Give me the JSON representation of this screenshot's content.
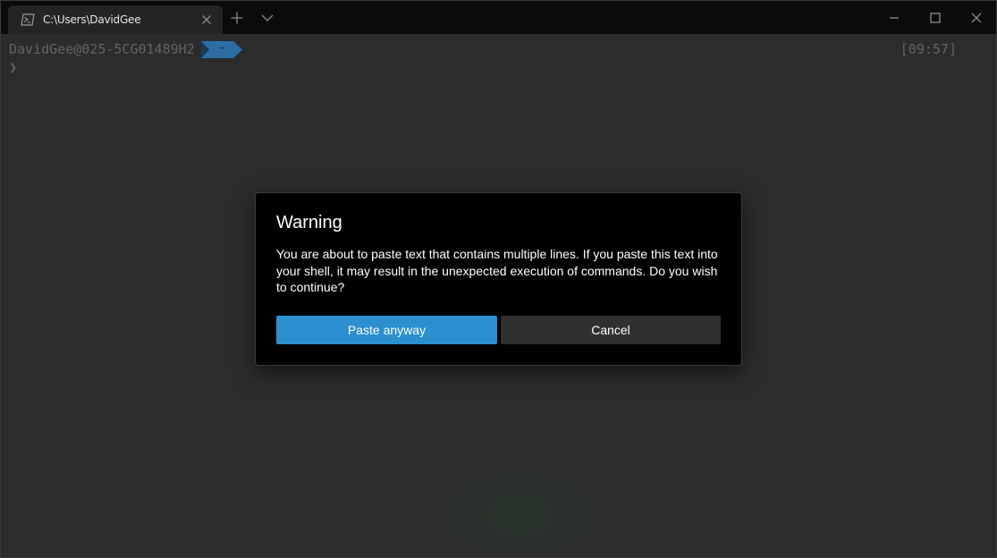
{
  "tab": {
    "title": "C:\\Users\\DavidGee",
    "icon": "powershell-icon"
  },
  "titlebar": {
    "new_tab_icon": "plus-icon",
    "dropdown_icon": "chevron-down-icon",
    "minimize_icon": "minimize-icon",
    "maximize_icon": "maximize-icon",
    "close_icon": "close-icon"
  },
  "terminal": {
    "prompt_user": "DavidGee@025-5CG01489H2",
    "prompt_path": "~",
    "prompt_time": "[09:57]",
    "prompt_caret": "❯",
    "accent_color": "#2c6da4"
  },
  "dialog": {
    "title": "Warning",
    "message": "You are about to paste text that contains multiple lines. If you paste this text into your shell, it may result in the unexpected execution of commands. Do you wish to continue?",
    "primary_button": "Paste anyway",
    "secondary_button": "Cancel",
    "primary_color": "#2b8fd0"
  }
}
